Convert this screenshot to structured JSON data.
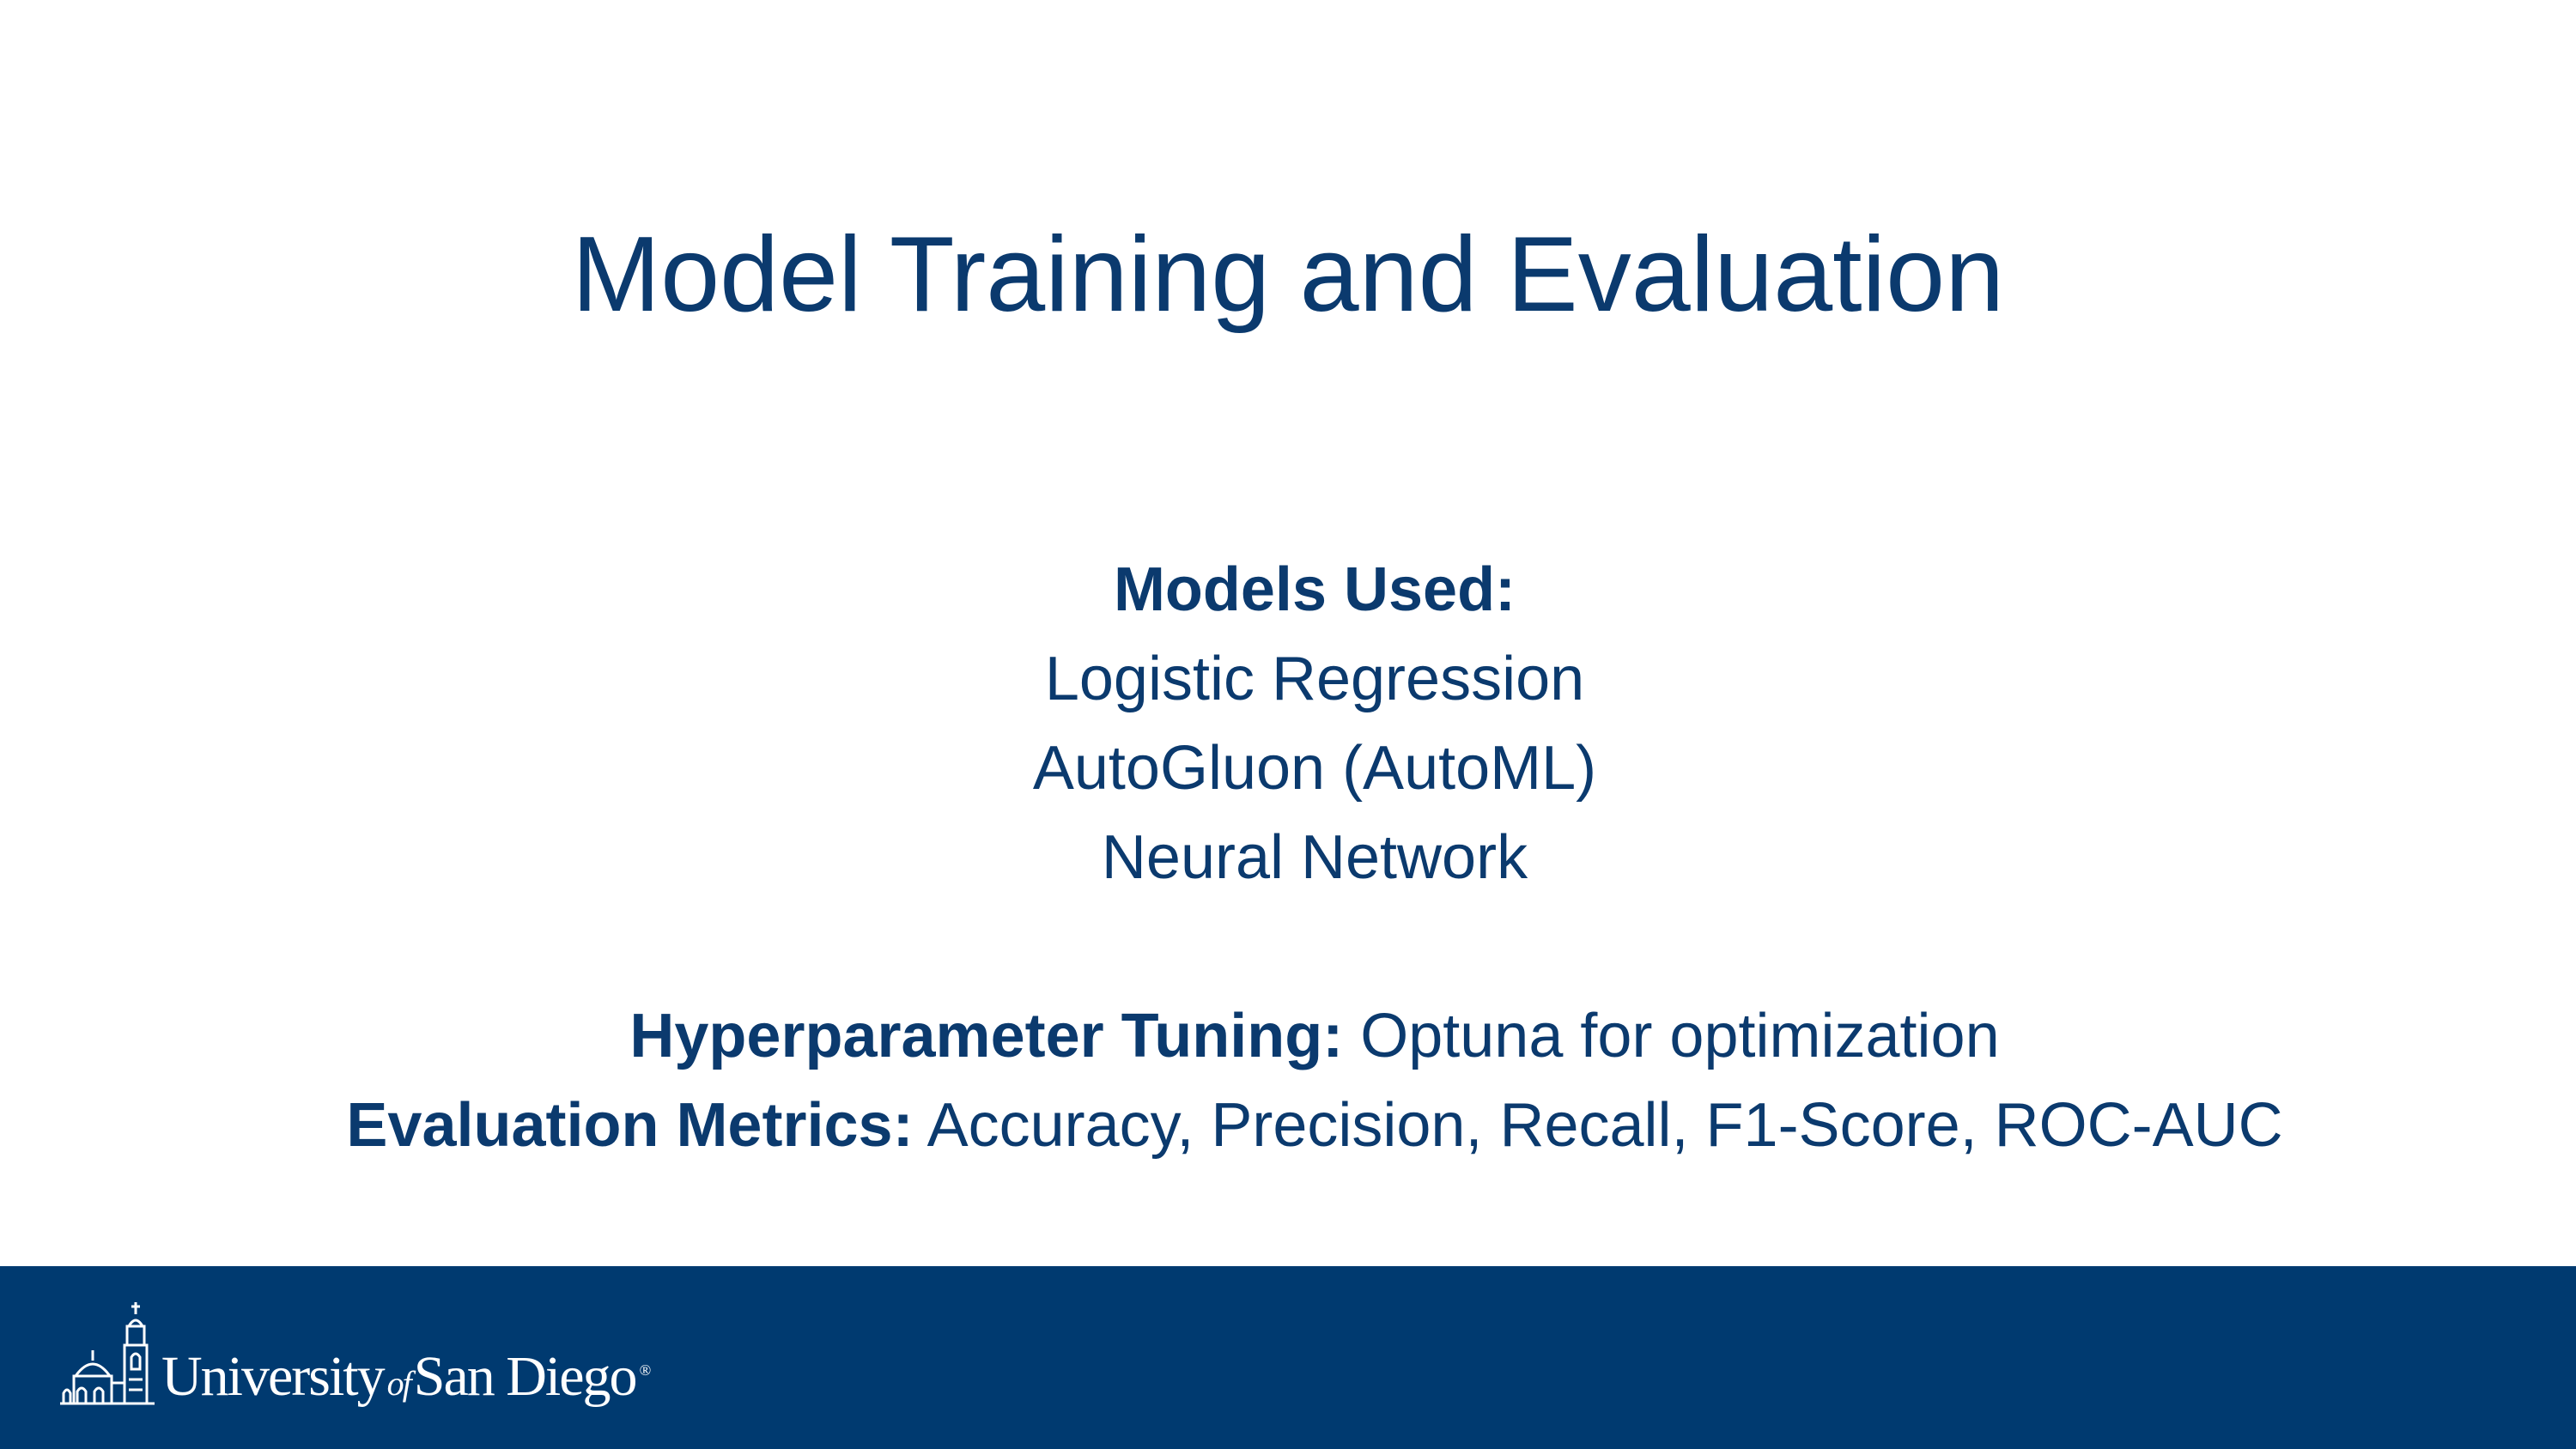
{
  "slide": {
    "title": "Model Training and Evaluation"
  },
  "content": {
    "models_heading": "Models Used:",
    "models": [
      "Logistic Regression",
      "AutoGluon (AutoML)",
      "Neural Network"
    ],
    "tuning_label": "Hyperparameter Tuning:",
    "tuning_value": " Optuna for optimization",
    "metrics_label": "Evaluation Metrics:",
    "metrics_value": " Accuracy, Precision, Recall, F1-Score, ROC-AUC"
  },
  "footer": {
    "logo": {
      "name_part1": "University",
      "name_of": "of",
      "name_part2": "San Diego",
      "registered": "®",
      "icon": "mission-building-icon"
    }
  },
  "colors": {
    "text": "#0b3a6e",
    "footer_bg": "#003a70",
    "background": "#ffffff"
  }
}
